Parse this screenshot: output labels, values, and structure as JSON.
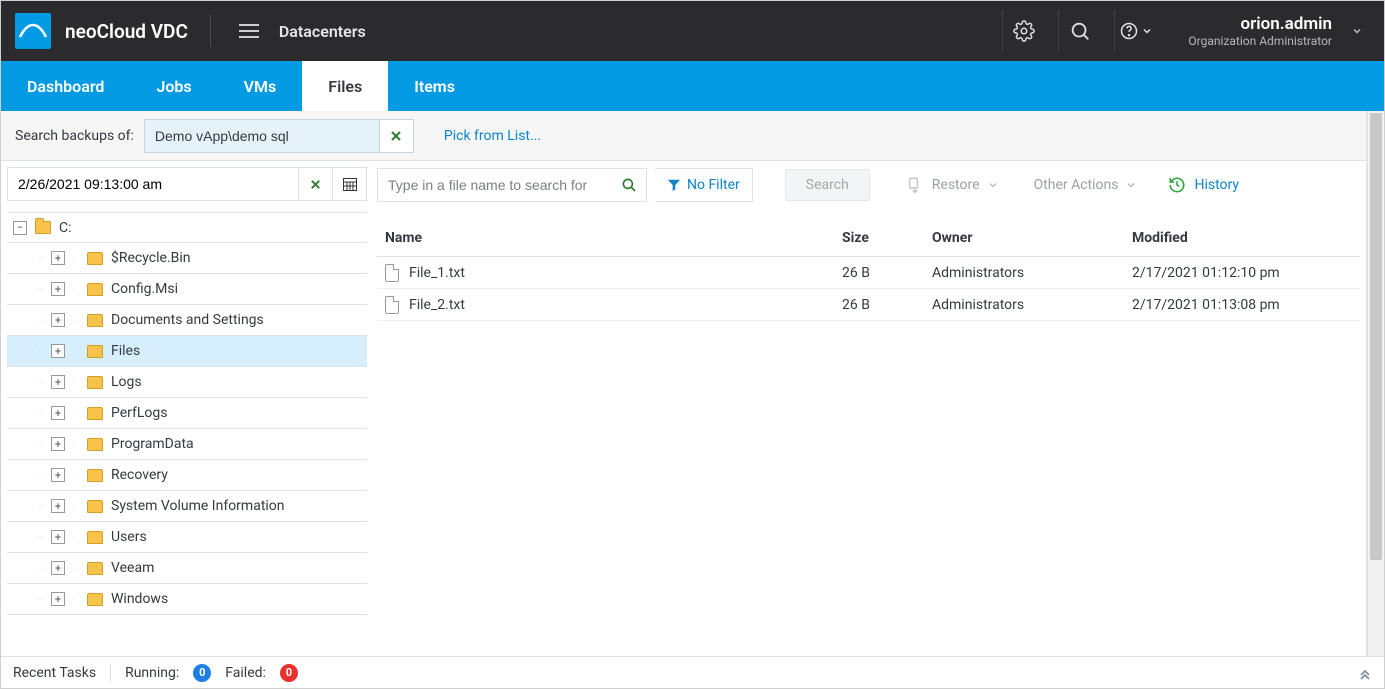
{
  "app": {
    "name": "neoCloud VDC",
    "breadcrumb": "Datacenters"
  },
  "user": {
    "name": "orion.admin",
    "role": "Organization Administrator"
  },
  "help": {
    "label": "?"
  },
  "tabs": [
    {
      "id": "dashboard",
      "label": "Dashboard"
    },
    {
      "id": "jobs",
      "label": "Jobs"
    },
    {
      "id": "vms",
      "label": "VMs"
    },
    {
      "id": "files",
      "label": "Files"
    },
    {
      "id": "items",
      "label": "Items"
    }
  ],
  "activeTab": "files",
  "searchBackups": {
    "label": "Search backups of:",
    "value": "Demo vApp\\demo sql",
    "pick": "Pick from List..."
  },
  "restorePoint": {
    "date": "2/26/2021 09:13:00 am"
  },
  "tree": {
    "root": {
      "label": "C:"
    },
    "children": [
      {
        "label": "$Recycle.Bin"
      },
      {
        "label": "Config.Msi"
      },
      {
        "label": "Documents and Settings"
      },
      {
        "label": "Files"
      },
      {
        "label": "Logs"
      },
      {
        "label": "PerfLogs"
      },
      {
        "label": "ProgramData"
      },
      {
        "label": "Recovery"
      },
      {
        "label": "System Volume Information"
      },
      {
        "label": "Users"
      },
      {
        "label": "Veeam"
      },
      {
        "label": "Windows"
      }
    ],
    "selected": "Files"
  },
  "fileSearch": {
    "placeholder": "Type in a file name to search for"
  },
  "filter": {
    "label": "No Filter"
  },
  "buttons": {
    "search": "Search",
    "restore": "Restore",
    "other": "Other Actions",
    "history": "History"
  },
  "table": {
    "headers": {
      "name": "Name",
      "size": "Size",
      "owner": "Owner",
      "modified": "Modified"
    },
    "rows": [
      {
        "name": "File_1.txt",
        "size": "26 B",
        "owner": "Administrators",
        "modified": "2/17/2021 01:12:10 pm"
      },
      {
        "name": "File_2.txt",
        "size": "26 B",
        "owner": "Administrators",
        "modified": "2/17/2021 01:13:08 pm"
      }
    ]
  },
  "status": {
    "recent": "Recent Tasks",
    "running": "Running:",
    "runningCount": "0",
    "failed": "Failed:",
    "failedCount": "0"
  }
}
